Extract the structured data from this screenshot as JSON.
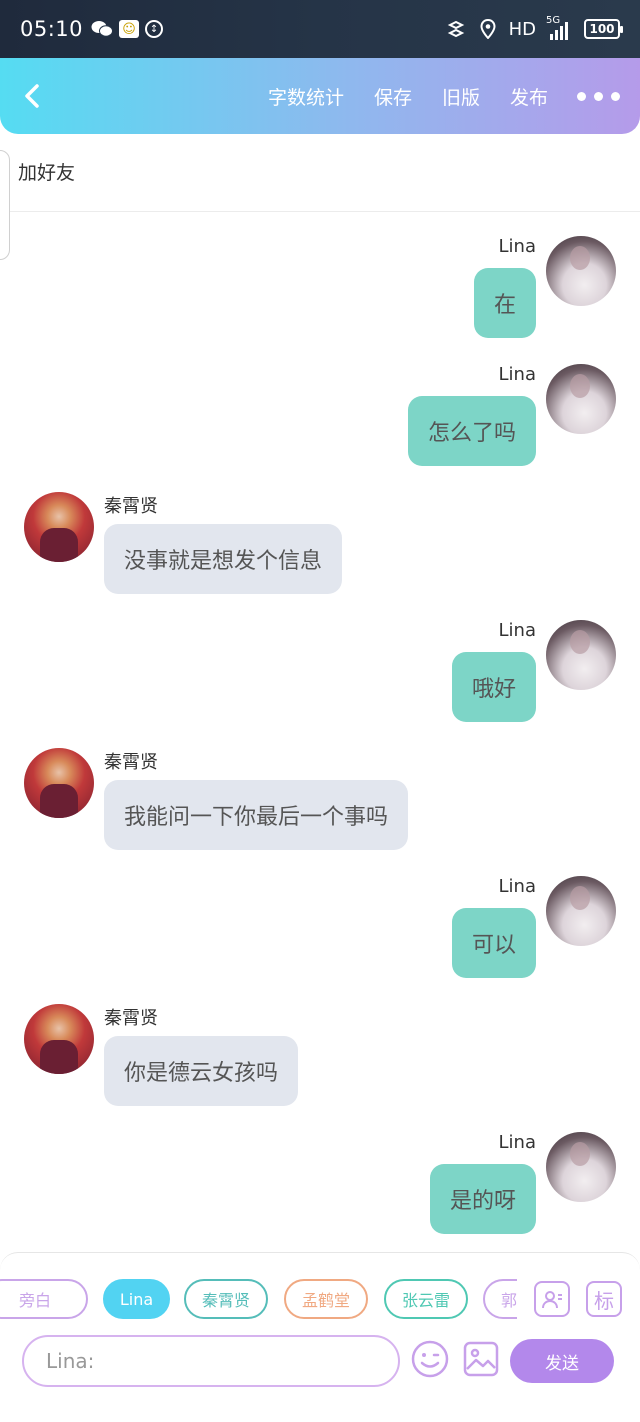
{
  "status_bar": {
    "time": "05:10",
    "left_icons": [
      "wechat-icon",
      "qq-icon",
      "data-saver-icon"
    ],
    "right_icons": [
      "hotspot-icon",
      "location-icon"
    ],
    "hd_label": "HD",
    "network_label": "5G",
    "battery": "100"
  },
  "header": {
    "back_icon": "chevron-left-icon",
    "actions": {
      "word_count": "字数统计",
      "save": "保存",
      "old_version": "旧版",
      "publish": "发布"
    },
    "more_icon": "more-horizontal-icon"
  },
  "add_friend": {
    "label": "加好友"
  },
  "messages": [
    {
      "sender": "Lina",
      "side": "right",
      "text": "在"
    },
    {
      "sender": "Lina",
      "side": "right",
      "text": "怎么了吗"
    },
    {
      "sender": "秦霄贤",
      "side": "left",
      "text": "没事就是想发个信息"
    },
    {
      "sender": "Lina",
      "side": "right",
      "text": "哦好"
    },
    {
      "sender": "秦霄贤",
      "side": "left",
      "text": "我能问一下你最后一个事吗"
    },
    {
      "sender": "Lina",
      "side": "right",
      "text": "可以"
    },
    {
      "sender": "秦霄贤",
      "side": "left",
      "text": "你是德云女孩吗"
    },
    {
      "sender": "Lina",
      "side": "right",
      "text": "是的呀"
    }
  ],
  "composer": {
    "characters": [
      "旁白",
      "Lina",
      "秦霄贤",
      "孟鹤堂",
      "张云雷",
      "郭"
    ],
    "selected_character": "Lina",
    "character_icon": "user-card-icon",
    "tag_label": "标",
    "input_placeholder": "Lina:",
    "emoji_icon": "emoji-icon",
    "image_icon": "image-icon",
    "send_label": "发送"
  },
  "colors": {
    "accent": "#b388eb",
    "header_start": "#55dcf2",
    "header_end": "#b59bea",
    "my_bubble": "#7dd5c7",
    "their_bubble": "#e2e6ee"
  }
}
